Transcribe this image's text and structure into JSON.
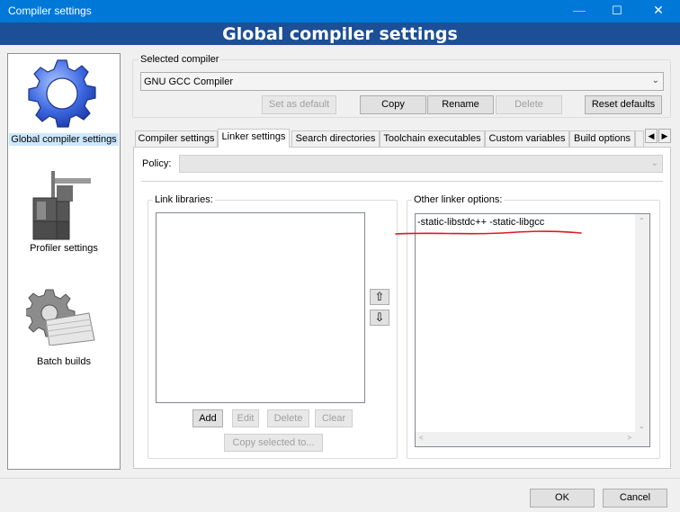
{
  "window": {
    "title": "Compiler settings",
    "banner": "Global compiler settings"
  },
  "sidebar": {
    "items": [
      {
        "label": "Global compiler settings",
        "icon": "gear-icon",
        "selected": true
      },
      {
        "label": "Profiler settings",
        "icon": "profiler-icon",
        "selected": false
      },
      {
        "label": "Batch builds",
        "icon": "batch-builds-icon",
        "selected": false
      }
    ]
  },
  "compiler": {
    "group_label": "Selected compiler",
    "value": "GNU GCC Compiler",
    "buttons": {
      "set_default": "Set as default",
      "copy": "Copy",
      "rename": "Rename",
      "delete": "Delete",
      "reset": "Reset defaults"
    }
  },
  "tabs": [
    {
      "label": "Compiler settings",
      "active": false
    },
    {
      "label": "Linker settings",
      "active": true
    },
    {
      "label": "Search directories",
      "active": false
    },
    {
      "label": "Toolchain executables",
      "active": false
    },
    {
      "label": "Custom variables",
      "active": false
    },
    {
      "label": "Build options",
      "active": false
    }
  ],
  "policy": {
    "label": "Policy:",
    "value": ""
  },
  "link_libraries": {
    "label": "Link libraries:",
    "items": [],
    "buttons": {
      "add": "Add",
      "edit": "Edit",
      "delete": "Delete",
      "clear": "Clear",
      "copy_selected": "Copy selected to..."
    }
  },
  "other_options": {
    "label": "Other linker options:",
    "text": "-static-libstdc++ -static-libgcc"
  },
  "footer": {
    "ok": "OK",
    "cancel": "Cancel"
  },
  "colors": {
    "titlebar": "#0078d7",
    "banner": "#1c4f95",
    "annotation": "#e0181f"
  }
}
